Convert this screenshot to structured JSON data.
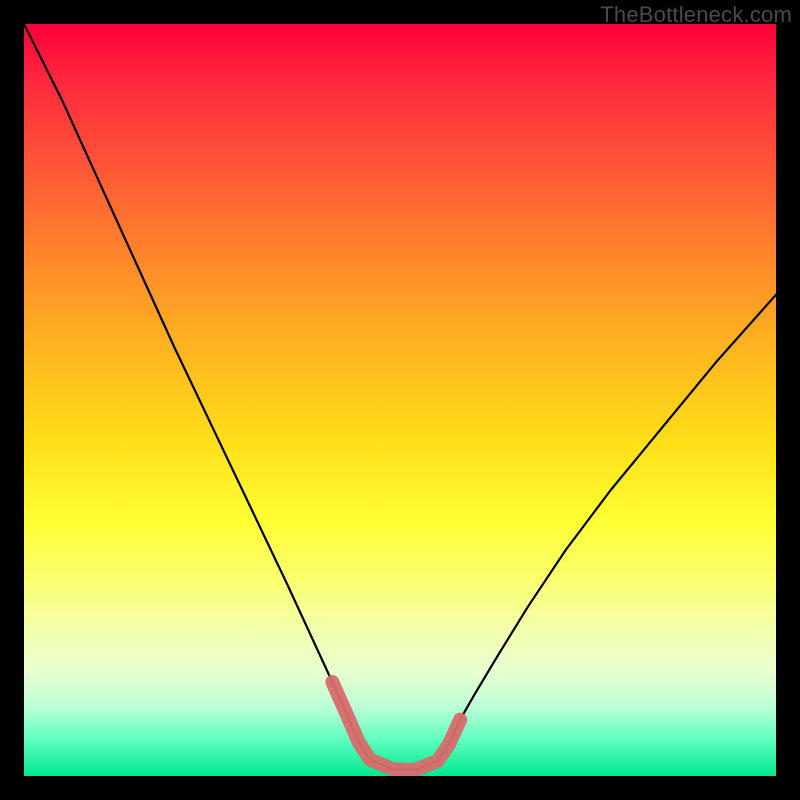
{
  "watermark": "TheBottleneck.com",
  "chart_data": {
    "type": "line",
    "title": "",
    "xlabel": "",
    "ylabel": "",
    "xlim": [
      0,
      100
    ],
    "ylim": [
      0,
      100
    ],
    "grid": false,
    "legend": false,
    "series": [
      {
        "name": "curve",
        "color": "#000000",
        "x": [
          0,
          5,
          10,
          15,
          20,
          25,
          30,
          35,
          38,
          41,
          43,
          44.5,
          46,
          49,
          52,
          55,
          56.5,
          58,
          60,
          63,
          67,
          72,
          78,
          85,
          92,
          100
        ],
        "y": [
          100,
          90,
          79,
          68,
          57,
          46.5,
          36,
          25.5,
          19,
          12.5,
          8,
          4.5,
          2.2,
          0.9,
          0.8,
          2.0,
          4.2,
          7.5,
          11,
          16,
          22.5,
          30,
          38,
          46.5,
          55,
          64
        ]
      },
      {
        "name": "highlight-band",
        "color": "#d86b6b",
        "x": [
          41,
          43,
          44.5,
          46,
          49,
          52,
          55,
          56.5,
          58
        ],
        "y": [
          12.5,
          8,
          4.5,
          2.2,
          0.9,
          0.8,
          2.0,
          4.2,
          7.5
        ]
      }
    ]
  }
}
